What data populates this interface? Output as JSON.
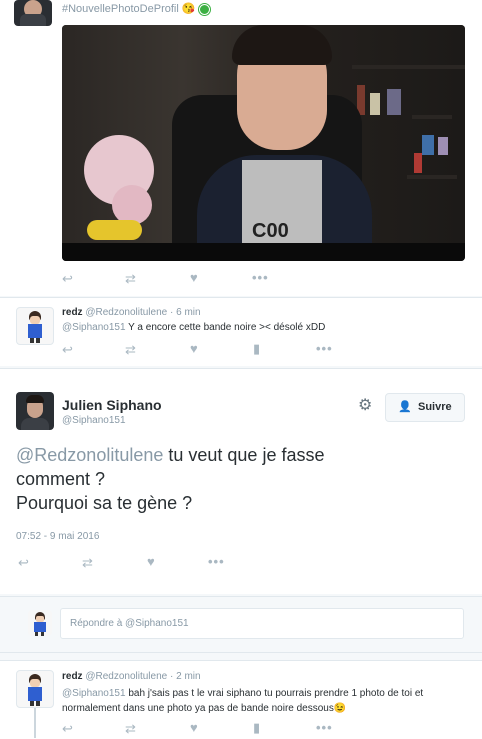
{
  "tweet_top": {
    "hashtag": "#NouvellePhotoDeProfil",
    "emoji": "😘"
  },
  "reply1": {
    "name": "redz",
    "handle": "@Redzonolitulene",
    "sep": "·",
    "time": "6 min",
    "mention": "@Siphano151",
    "text": " Y a encore cette bande noire >< désolé xDD"
  },
  "main_tweet": {
    "name": "Julien Siphano",
    "handle": "@Siphano151",
    "follow_label": "Suivre",
    "mention": "@Redzonolitulene",
    "text_line1": " tu veut que je fasse",
    "text_line2": "comment ?",
    "text_line3": "Pourquoi sa te gène ?",
    "timestamp": "07:52 - 9 mai 2016"
  },
  "reply_box": {
    "placeholder": "Répondre à @Siphano151"
  },
  "reply2": {
    "name": "redz",
    "handle": "@Redzonolitulene",
    "sep": "·",
    "time": "2 min",
    "mention": "@Siphano151",
    "text_line1": " bah j'sais pas t le vrai siphano tu pourrais prendre 1 photo de toi et",
    "text_line2": "normalement dans une photo ya pas de bande noire dessous",
    "emoji": "😉"
  },
  "icons": {
    "reply": "reply-icon",
    "retweet": "retweet-icon",
    "like": "heart-icon",
    "more": "more-icon",
    "analytics": "analytics-icon",
    "gear": "gear-icon",
    "follow": "add-user-icon"
  },
  "colors": {
    "link_gray": "#8899a6",
    "follow_blue": "#1da1f2",
    "text": "#292f33"
  }
}
